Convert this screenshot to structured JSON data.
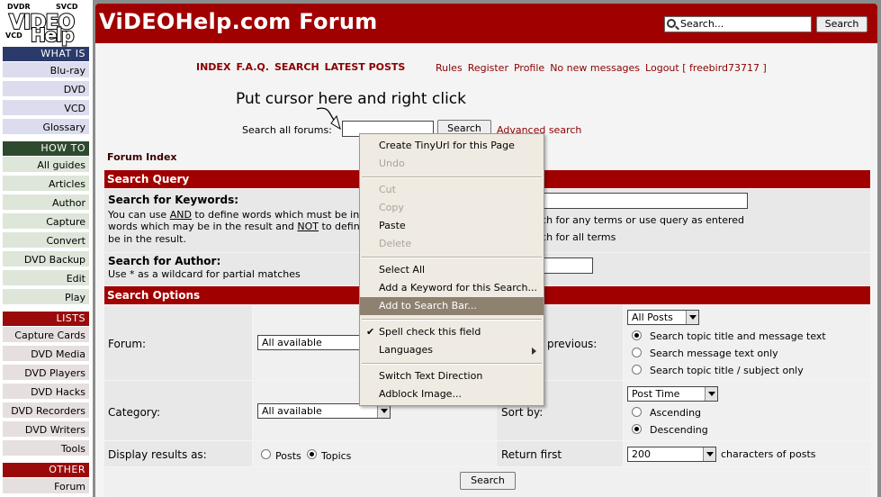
{
  "logo": {
    "dvdr": "DVDR",
    "svcd": "SVCD",
    "vcd": "VCD",
    "video": "VIDEO",
    "help": "Help"
  },
  "sidebar": {
    "what_is": {
      "title": "WHAT IS",
      "items": [
        "Blu-ray",
        "DVD",
        "VCD",
        "Glossary"
      ]
    },
    "how_to": {
      "title": "HOW TO",
      "items": [
        "All guides",
        "Articles",
        "Author",
        "Capture",
        "Convert",
        "DVD Backup",
        "Edit",
        "Play"
      ]
    },
    "lists": {
      "title": "LISTS",
      "items": [
        "Capture Cards",
        "DVD Media",
        "DVD Players",
        "DVD Hacks",
        "DVD Recorders",
        "DVD Writers",
        "Tools"
      ]
    },
    "other": {
      "title": "OTHER",
      "items": [
        "Forum"
      ]
    }
  },
  "header": {
    "title": "ViDEOHelp.com Forum",
    "search_placeholder": "Search...",
    "search_button": "Search"
  },
  "nav": {
    "primary": [
      "INDEX",
      "F.A.Q.",
      "SEARCH",
      "LATEST POSTS"
    ],
    "secondary": [
      "Rules",
      "Register",
      "Profile",
      "No new messages",
      "Logout [ freebird73717 ]"
    ]
  },
  "annotation": "Put cursor here and right click",
  "forum_search": {
    "label": "Search all forums:",
    "button": "Search",
    "advanced": "Advanced search"
  },
  "breadcrumb": "Forum Index",
  "search_query": {
    "title": "Search Query",
    "keywords_label": "Search for Keywords:",
    "keywords_help_1": "You can use",
    "keywords_and": "AND",
    "keywords_help_2": "to define words which must be in",
    "keywords_help_3": "words which may be in the result and",
    "keywords_not": "NOT",
    "keywords_help_4": "to defin",
    "keywords_help_5": "be in the result.",
    "any_terms": "arch for any terms or use query as entered",
    "all_terms": "arch for all terms",
    "author_label": "Search for Author:",
    "author_help": "Use * as a wildcard for partial matches"
  },
  "search_options": {
    "title": "Search Options",
    "forum_label": "Forum:",
    "forum_value": "All available",
    "previous_label": "previous:",
    "previous_value": "All Posts",
    "scope_options": [
      "Search topic title and message text",
      "Search message text only",
      "Search topic title / subject only"
    ],
    "category_label": "Category:",
    "category_value": "All available",
    "sort_label": "Sort by:",
    "sort_value": "Post Time",
    "sort_options": [
      "Ascending",
      "Descending"
    ],
    "display_label": "Display results as:",
    "display_options": [
      "Posts",
      "Topics"
    ],
    "return_label": "Return first",
    "return_value": "200",
    "return_suffix": "characters of posts",
    "submit": "Search"
  },
  "context_menu": {
    "items": [
      "Create TinyUrl for this Page",
      "Undo",
      "Cut",
      "Copy",
      "Paste",
      "Delete",
      "Select All",
      "Add a Keyword for this Search...",
      "Add to Search Bar...",
      "Spell check this field",
      "Languages",
      "Switch Text Direction",
      "Adblock Image..."
    ]
  }
}
